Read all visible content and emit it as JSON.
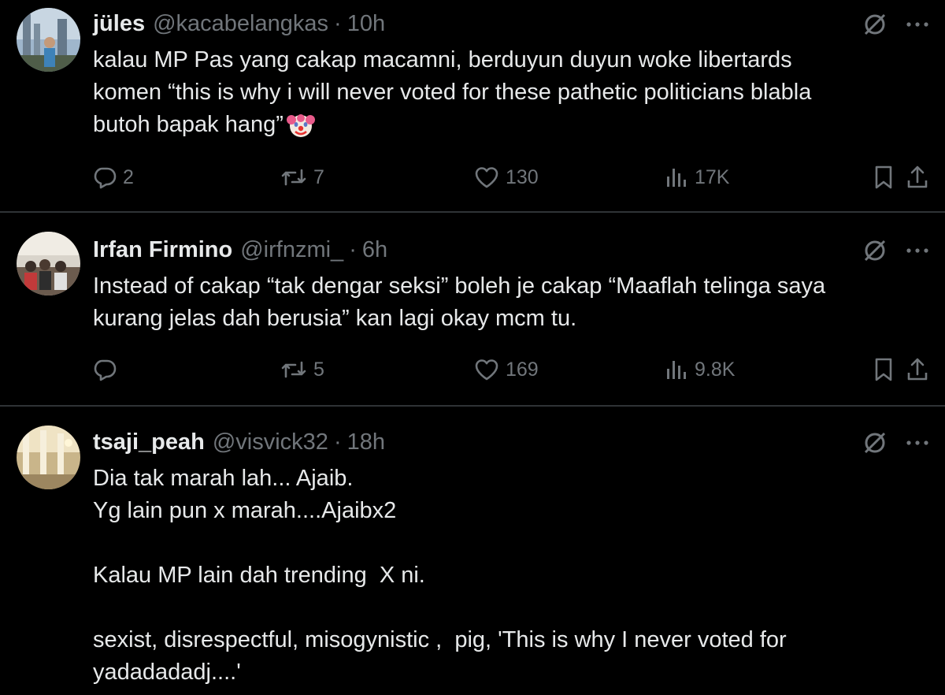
{
  "tweets": [
    {
      "name": "jüles",
      "handle": "@kacabelangkas",
      "time": "10h",
      "lines": [
        "kalau MP Pas yang cakap macamni, berduyun duyun woke libertards",
        "komen “this is why i will never voted for these pathetic politicians blabla",
        "butoh bapak hang”"
      ],
      "emoji": "clown-face",
      "stats": {
        "replies": "2",
        "reposts": "7",
        "likes": "130",
        "views": "17K"
      }
    },
    {
      "name": "Irfan Firmino",
      "handle": "@irfnzmi_",
      "time": "6h",
      "lines": [
        "Instead of cakap “tak dengar seksi” boleh je cakap “Maaflah telinga saya",
        "kurang jelas dah berusia” kan lagi okay mcm tu."
      ],
      "stats": {
        "replies": "",
        "reposts": "5",
        "likes": "169",
        "views": "9.8K"
      }
    },
    {
      "name": "tsaji_peah",
      "handle": "@visvick32",
      "time": "18h",
      "lines": [
        "Dia tak marah lah... Ajaib.",
        "Yg lain pun x marah....Ajaibx2",
        "",
        "Kalau MP lain dah trending  X ni.",
        "",
        "sexist, disrespectful, misogynistic ,  pig, 'This is why I never voted for",
        "yadadadadj....'"
      ]
    }
  ],
  "separator": "·",
  "icons": [
    "grok-icon",
    "more-icon",
    "reply-icon",
    "repost-icon",
    "like-icon",
    "views-icon",
    "bookmark-icon",
    "share-icon"
  ],
  "colors": {
    "background": "#000000",
    "text": "#e7e9ea",
    "muted": "#71767b",
    "divider": "#2f3336"
  }
}
